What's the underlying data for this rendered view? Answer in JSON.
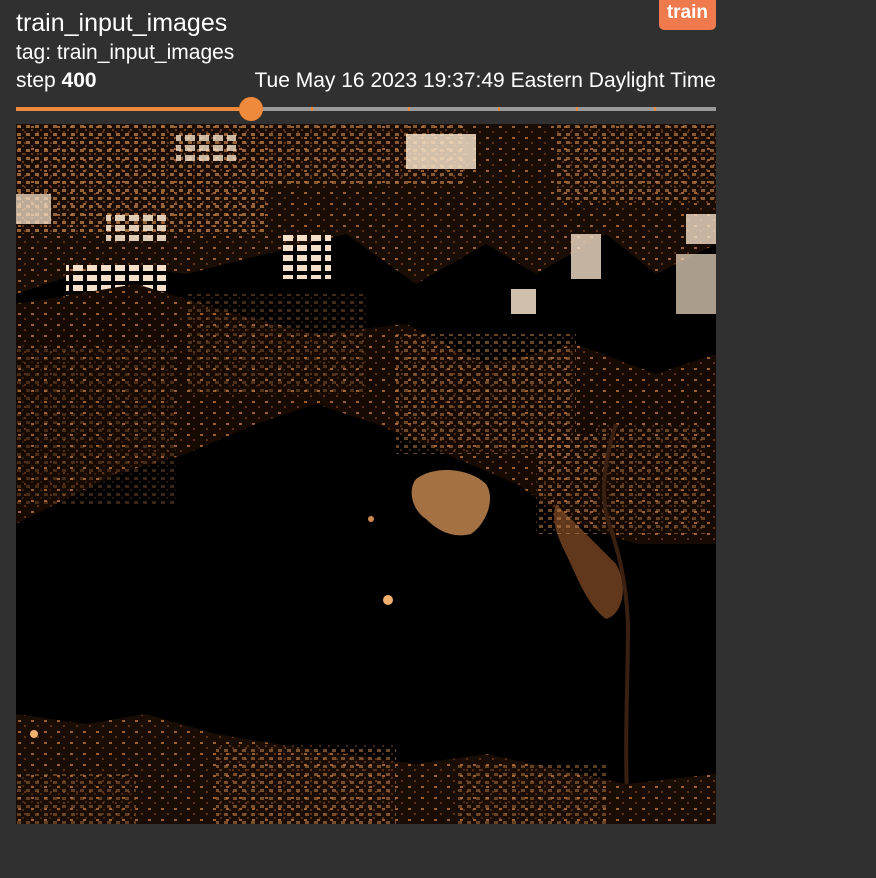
{
  "card": {
    "title": "train_input_images",
    "run_badge": "train",
    "tag_line": "tag: train_input_images",
    "step_label": "step",
    "step_value": "400",
    "timestamp": "Tue May 16 2023 19:37:49 Eastern Daylight Time"
  },
  "slider": {
    "progress": 0.336,
    "tick_positions": [
      0.129,
      0.277,
      0.421,
      0.56,
      0.689,
      0.8,
      0.912
    ],
    "accent_color": "#ef8a3d",
    "track_color": "#9a9a9a"
  },
  "image": {
    "description_icon": "satellite-image",
    "colors": {
      "background": "#000000",
      "urban_bright": "#f4e0c8",
      "urban_mid": "#b67a45",
      "urban_dark": "#5c3216"
    }
  },
  "colors": {
    "page_background": "#303030",
    "badge_background": "#ef7a4d",
    "text": "#ffffff"
  }
}
